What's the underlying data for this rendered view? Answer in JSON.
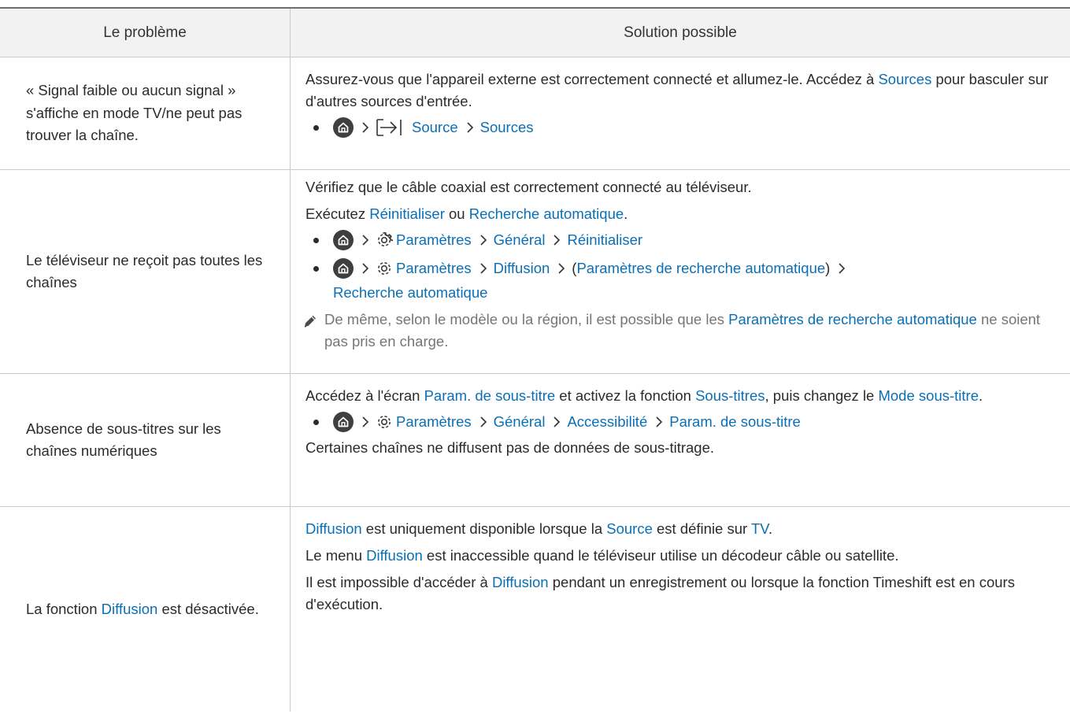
{
  "table": {
    "headers": [
      "Le problème",
      "Solution possible"
    ],
    "rows": [
      {
        "problem": "« Signal faible ou aucun signal » s'affiche en mode TV/ne peut pas trouver la chaîne.",
        "para1": {
          "t1": "Assurez-vous que l'appareil externe est correctement connecté et allumez-le. Accédez à ",
          "l1": "Sources",
          "t2": " pour basculer sur d'autres sources d'entrée."
        },
        "path": [
          "Source",
          "Sources"
        ]
      },
      {
        "problem": "Le téléviseur ne reçoit pas toutes les chaînes",
        "para1": "Vérifiez que le câble coaxial est correctement connecté au téléviseur.",
        "para2": {
          "t1": "Exécutez ",
          "l1": "Réinitialiser",
          "t2": " ou ",
          "l2": "Recherche automatique",
          "t3": "."
        },
        "path1": [
          "Paramètres",
          "Général",
          "Réinitialiser"
        ],
        "path2": [
          "Paramètres",
          "Diffusion",
          "Paramètres de recherche automatique",
          "Recherche automatique"
        ],
        "note": {
          "t1": "De même, selon le modèle ou la région, il est possible que les ",
          "l1": "Paramètres de recherche automatique",
          "t2": " ne soient pas pris en charge."
        }
      },
      {
        "problem": "Absence de sous-titres sur les chaînes numériques",
        "para1": {
          "t1": "Accédez à l'écran ",
          "l1": "Param. de sous-titre",
          "t2": " et activez la fonction ",
          "l2": "Sous-titres",
          "t3": ", puis changez le ",
          "l3": "Mode sous-titre",
          "t4": "."
        },
        "path": [
          "Paramètres",
          "Général",
          "Accessibilité",
          "Param. de sous-titre"
        ],
        "para2": "Certaines chaînes ne diffusent pas de données de sous-titrage."
      },
      {
        "problem": {
          "t1": "La fonction ",
          "l1": "Diffusion",
          "t2": " est désactivée."
        },
        "para1": {
          "l1": "Diffusion",
          "t1": " est uniquement disponible lorsque la ",
          "l2": "Source",
          "t2": " est définie sur ",
          "l3": "TV",
          "t3": "."
        },
        "para2": {
          "t1": "Le menu ",
          "l1": "Diffusion",
          "t2": " est inaccessible quand le téléviseur utilise un décodeur câble ou satellite."
        },
        "para3": {
          "t1": "Il est impossible d'accéder à ",
          "l1": "Diffusion",
          "t2": " pendant un enregistrement ou lorsque la fonction Timeshift est en cours d'exécution."
        }
      }
    ]
  },
  "icons": {
    "home": "home-icon",
    "settings": "gear-icon",
    "source": "source-input-icon",
    "chevron": "chevron-right-icon",
    "note": "pencil-note-icon"
  },
  "colors": {
    "link": "#0a6fb5",
    "header_bg": "#f2f2f2",
    "border": "#c9c9c9"
  }
}
